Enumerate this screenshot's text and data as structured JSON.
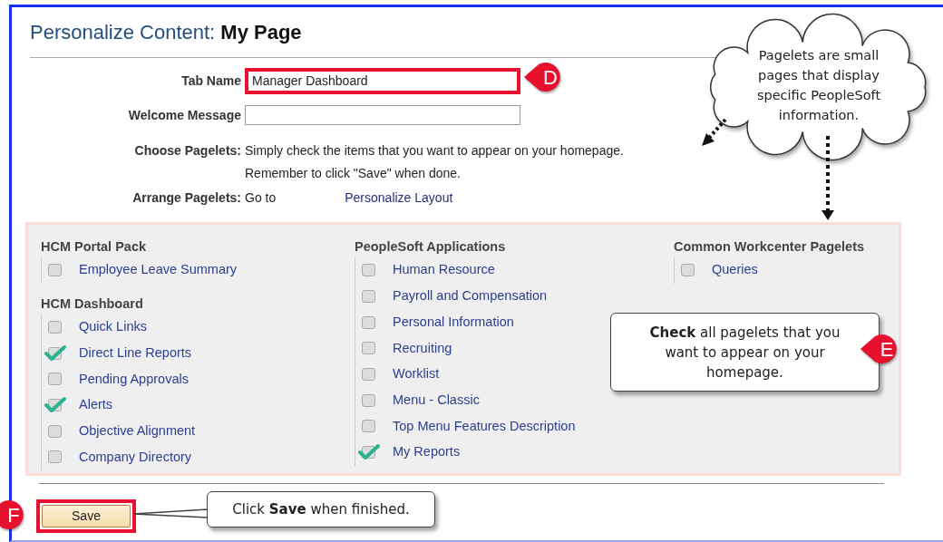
{
  "title": {
    "prefix": "Personalize Content:",
    "name": "My Page"
  },
  "fields": [
    {
      "kind": "input",
      "label": "Tab Name",
      "value": "Manager Dashboard",
      "highlighted": true,
      "marker": "D"
    },
    {
      "kind": "input",
      "label": "Welcome Message",
      "highlighted": false
    },
    {
      "kind": "text",
      "label": "Choose Pagelets:",
      "lines": [
        "Simply check the items that you want to appear on your homepage.",
        "Remember to click \"Save\" when done."
      ]
    },
    {
      "kind": "link",
      "label": "Arrange Pagelets:",
      "text": "Go to",
      "link": "Personalize Layout"
    }
  ],
  "pagelet_columns": [
    {
      "groups": [
        {
          "title": "HCM Portal Pack",
          "items": [
            {
              "label": "Employee Leave Summary",
              "checked": false
            }
          ]
        },
        {
          "title": "HCM Dashboard",
          "items": [
            {
              "label": "Quick Links",
              "checked": false
            },
            {
              "label": "Direct Line Reports",
              "checked": true
            },
            {
              "label": "Pending Approvals",
              "checked": false
            },
            {
              "label": "Alerts",
              "checked": true
            },
            {
              "label": "Objective Alignment",
              "checked": false
            },
            {
              "label": "Company Directory",
              "checked": false
            }
          ]
        }
      ]
    },
    {
      "groups": [
        {
          "title": "PeopleSoft Applications",
          "items": [
            {
              "label": "Human Resource",
              "checked": false
            },
            {
              "label": "Payroll and Compensation",
              "checked": false
            },
            {
              "label": "Personal Information",
              "checked": false
            },
            {
              "label": "Recruiting",
              "checked": false
            },
            {
              "label": "Worklist",
              "checked": false
            },
            {
              "label": "Menu - Classic",
              "checked": false
            },
            {
              "label": "Top Menu Features Description",
              "checked": false
            },
            {
              "label": "My Reports",
              "checked": true
            }
          ]
        }
      ]
    },
    {
      "groups": [
        {
          "title": "Common Workcenter Pagelets",
          "items": [
            {
              "label": "Queries",
              "checked": false
            }
          ]
        }
      ]
    }
  ],
  "save_button": {
    "label": "Save",
    "highlighted": true,
    "marker": "F"
  },
  "callouts": [
    {
      "kind": "cloud",
      "text": "Pagelets are small pages that display specific PeopleSoft information."
    },
    {
      "kind": "box",
      "text": "**Check** all pagelets that you want to appear on your homepage.",
      "marker": "E"
    },
    {
      "kind": "box",
      "text": "Click **Save** when finished."
    }
  ]
}
